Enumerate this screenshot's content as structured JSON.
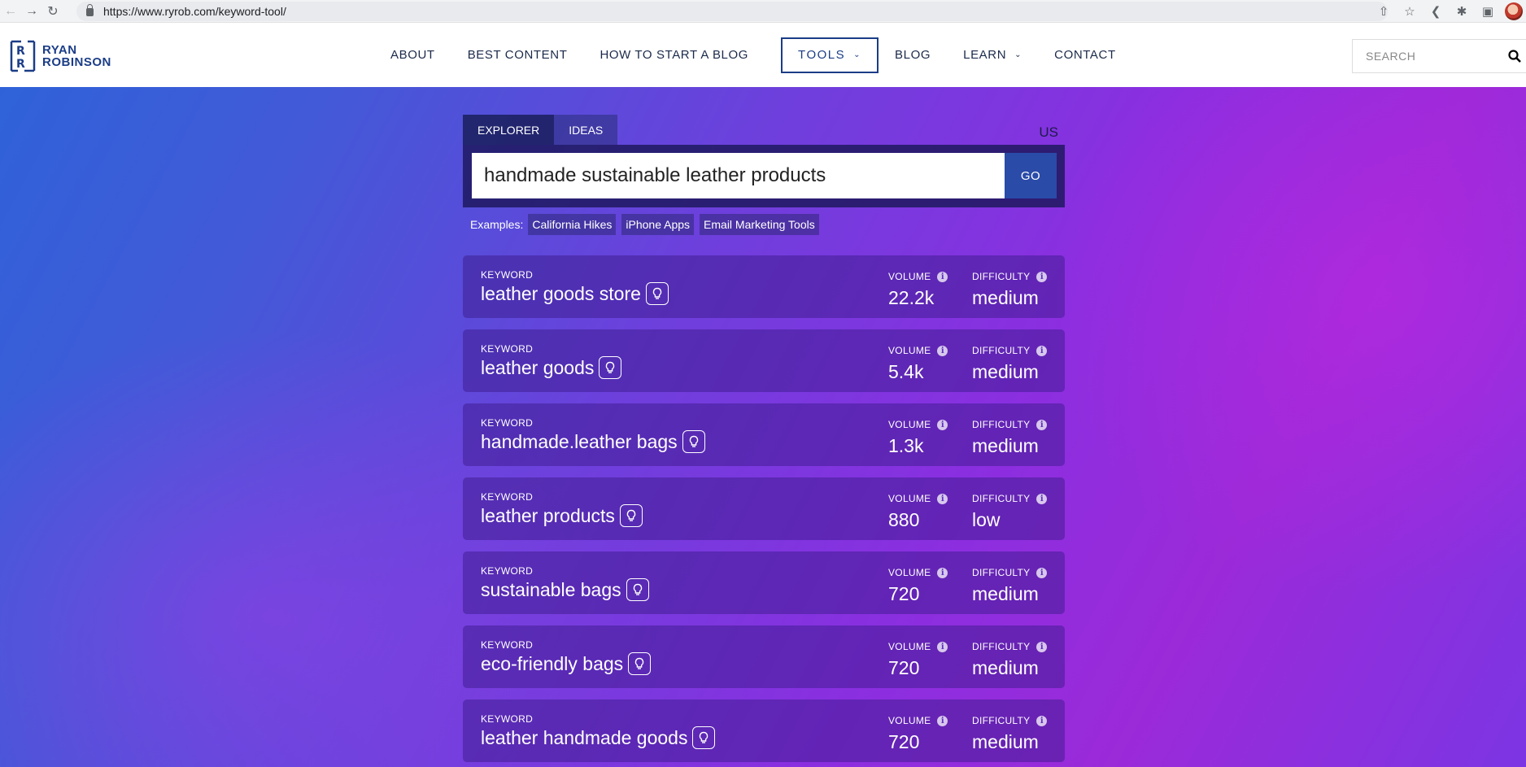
{
  "browser": {
    "url": "https://www.ryrob.com/keyword-tool/",
    "icons": [
      "back-icon",
      "forward-icon",
      "reload-icon",
      "lock-icon",
      "share-icon",
      "star-icon",
      "vscode-icon",
      "extensions-icon",
      "sidebar-icon",
      "profile-avatar"
    ]
  },
  "site": {
    "logo_line1": "RYAN",
    "logo_line2": "ROBINSON",
    "nav": [
      {
        "label": "ABOUT"
      },
      {
        "label": "BEST CONTENT"
      },
      {
        "label": "HOW TO START A BLOG"
      },
      {
        "label": "TOOLS"
      },
      {
        "label": "BLOG"
      },
      {
        "label": "LEARN"
      },
      {
        "label": "CONTACT"
      }
    ],
    "search_placeholder": "SEARCH"
  },
  "tool": {
    "tabs": [
      {
        "label": "EXPLORER"
      },
      {
        "label": "IDEAS"
      }
    ],
    "country": "US",
    "query": "handmade sustainable leather products",
    "go_label": "GO",
    "examples_label": "Examples:",
    "examples": [
      "California Hikes",
      "iPhone Apps",
      "Email Marketing Tools"
    ],
    "keyword_label": "KEYWORD",
    "volume_label": "VOLUME",
    "difficulty_label": "DIFFICULTY",
    "results": [
      {
        "keyword": "leather goods store",
        "volume": "22.2k",
        "difficulty": "medium"
      },
      {
        "keyword": "leather goods",
        "volume": "5.4k",
        "difficulty": "medium"
      },
      {
        "keyword": "handmade.leather bags",
        "volume": "1.3k",
        "difficulty": "medium"
      },
      {
        "keyword": "leather products",
        "volume": "880",
        "difficulty": "low"
      },
      {
        "keyword": "sustainable bags",
        "volume": "720",
        "difficulty": "medium"
      },
      {
        "keyword": "eco-friendly bags",
        "volume": "720",
        "difficulty": "medium"
      },
      {
        "keyword": "leather handmade goods",
        "volume": "720",
        "difficulty": "medium"
      }
    ]
  },
  "colors": {
    "brand_blue": "#1b3d87",
    "go_button": "#2a4ba8",
    "gradient_start": "#2f62d9",
    "gradient_end": "#9b2ad9"
  }
}
